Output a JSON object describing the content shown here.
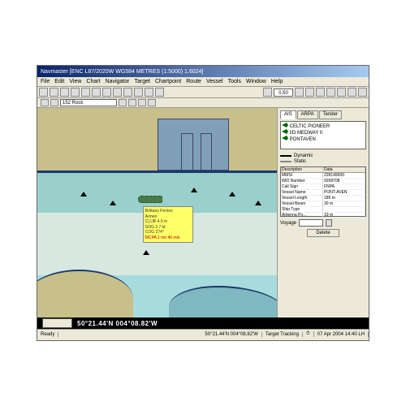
{
  "title": "Navmaster  [ENC  L87/2020W  WG584   METRES   (1:5000)   1.6024]",
  "menu": [
    "File",
    "Edit",
    "View",
    "Chart",
    "Navigator",
    "Target",
    "Chartpoint",
    "Route",
    "Vessel",
    "Tools",
    "Window",
    "Help"
  ],
  "scale_value": "0.50",
  "chart_selector": "152 Rock",
  "coords": "50°21.44'N 004°08.82'W",
  "tooltip": {
    "name": "Brittany Ferries",
    "line2": "Armen",
    "line3": "CLUB 4.0 m",
    "line4": "SOG  2.7 kt",
    "line5": "COG  274°",
    "line6": "MCPA  1 nm 40 min"
  },
  "panel": {
    "tabs": [
      "AIS",
      "ARPA",
      "Tender"
    ],
    "active_tab": "AIS",
    "targets": [
      "CELTIC PIONEER",
      "I/D MEDWAY II",
      "PONTAVEN"
    ],
    "legend": {
      "dynamic": "Dynamic",
      "static": "Static"
    },
    "grid_headers": [
      "Description",
      "Data"
    ],
    "grid_rows": [
      [
        "MMSI",
        "228149600"
      ],
      [
        "IMO Number",
        "9268708"
      ],
      [
        "Call Sign",
        "FNPA"
      ],
      [
        "Vessel Name",
        "PONT-AVEN"
      ],
      [
        "Vessel Length",
        "185 m"
      ],
      [
        "Vessel Beam",
        "30 m"
      ],
      [
        "Ship Type",
        ""
      ],
      [
        "Antenna Po...",
        "19 m"
      ]
    ],
    "voyage_label": "Voyage",
    "voyage_value": "",
    "delete_btn": "Delete"
  },
  "status": {
    "ready": "Ready",
    "center": "50°21.44'N 004°08.82'W",
    "tracking": "Target Tracking",
    "datetime": "07 Apr 2004  14:40 LH"
  }
}
